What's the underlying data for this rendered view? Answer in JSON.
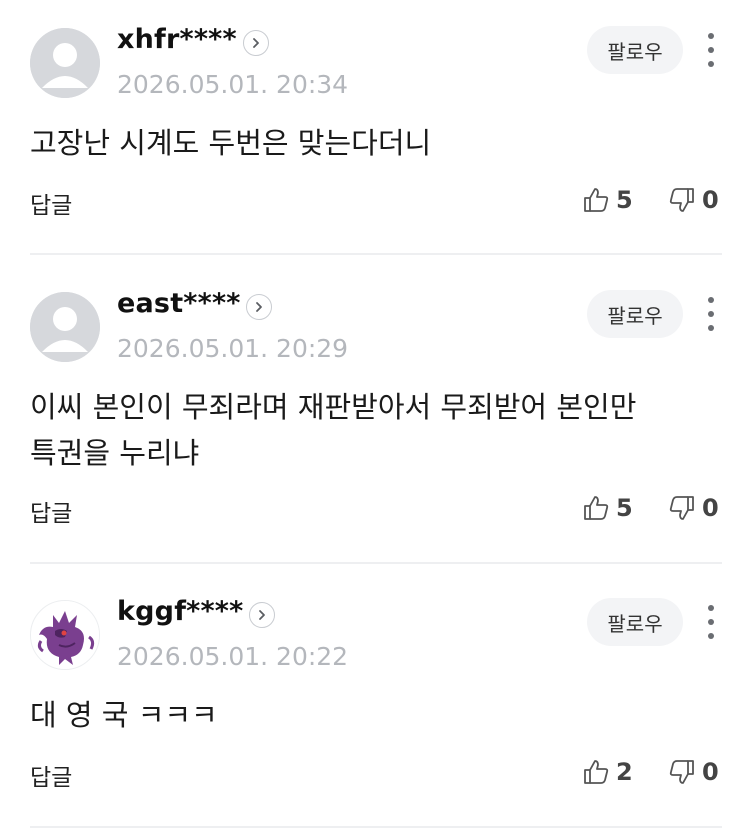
{
  "comments": [
    {
      "username": "xhfr****",
      "timestamp": "2026.05.01. 20:34",
      "follow_label": "팔로우",
      "text": "고장난 시계도 두번은 맞는다더니",
      "reply_label": "답글",
      "likes": "5",
      "dislikes": "0",
      "avatar_icon": "default-user-avatar"
    },
    {
      "username": "east****",
      "timestamp": "2026.05.01. 20:29",
      "follow_label": "팔로우",
      "text": "이씨 본인이 무죄라며 재판받아서 무죄받어 본인만\n특권을 누리냐",
      "reply_label": "답글",
      "likes": "5",
      "dislikes": "0",
      "avatar_icon": "default-user-avatar"
    },
    {
      "username": "kggf****",
      "timestamp": "2026.05.01. 20:22",
      "follow_label": "팔로우",
      "text": "대 영 국 ㅋㅋㅋ",
      "reply_label": "답글",
      "likes": "2",
      "dislikes": "0",
      "avatar_icon": "purple-monster-avatar"
    }
  ],
  "colors": {
    "text": "#1a1a1a",
    "timestamp": "#b4b7bc",
    "follow_bg": "#f3f4f6",
    "divider": "#eeeff1",
    "avatar_default": "#d6d8dc",
    "avatar_purple": "#7a3f8f"
  }
}
